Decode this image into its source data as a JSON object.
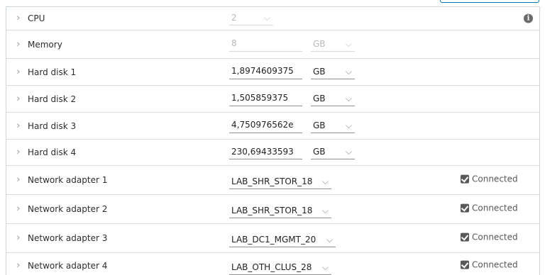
{
  "rows": [
    {
      "label": "CPU",
      "value": "2"
    },
    {
      "label": "Memory",
      "value": "8",
      "unit": "GB"
    },
    {
      "label": "Hard disk 1",
      "value": "1,8974609375",
      "unit": "GB"
    },
    {
      "label": "Hard disk 2",
      "value": "1,505859375",
      "unit": "GB"
    },
    {
      "label": "Hard disk 3",
      "value": "4,750976562е",
      "unit": "GB"
    },
    {
      "label": "Hard disk 4",
      "value": "230,69433593",
      "unit": "GB"
    },
    {
      "label": "Network adapter 1",
      "network": "LAB_SHR_STOR_18",
      "connected_label": "Connected",
      "connected": true
    },
    {
      "label": "Network adapter 2",
      "network": "LAB_SHR_STOR_18",
      "connected_label": "Connected",
      "connected": true
    },
    {
      "label": "Network adapter 3",
      "network": "LAB_DC1_MGMT_20",
      "connected_label": "Connected",
      "connected": true
    },
    {
      "label": "Network adapter 4",
      "network": "LAB_OTH_CLUS_28",
      "connected_label": "Connected",
      "connected": true
    }
  ],
  "icons": {
    "expand": "chevron-right-icon",
    "dropdown": "chevron-down-icon",
    "info": "info-icon",
    "checkbox": "checkbox-checked-icon"
  },
  "colors": {
    "border": "#cfd6db",
    "accent": "#0079b8",
    "disabled_text": "#b8b8b8"
  }
}
